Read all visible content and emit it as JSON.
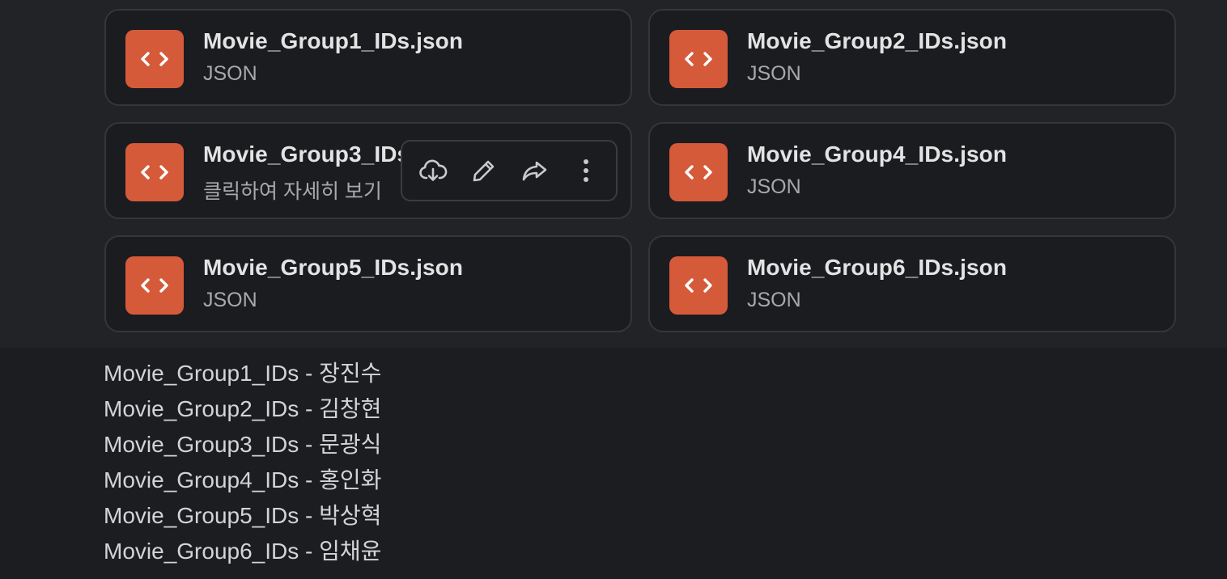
{
  "files": [
    {
      "name": "Movie_Group1_IDs.json",
      "type": "JSON",
      "icon": "code-file-icon"
    },
    {
      "name": "Movie_Group2_IDs.json",
      "type": "JSON",
      "icon": "code-file-icon"
    },
    {
      "name": "Movie_Group3_IDs.json",
      "type": "클릭하여 자세히 보기",
      "icon": "code-file-icon"
    },
    {
      "name": "Movie_Group4_IDs.json",
      "type": "JSON",
      "icon": "code-file-icon"
    },
    {
      "name": "Movie_Group5_IDs.json",
      "type": "JSON",
      "icon": "code-file-icon"
    },
    {
      "name": "Movie_Group6_IDs.json",
      "type": "JSON",
      "icon": "code-file-icon"
    }
  ],
  "hover_actions": [
    "download-cloud-icon",
    "edit-pencil-icon",
    "share-forward-icon",
    "more-vertical-icon"
  ],
  "message_lines": [
    "Movie_Group1_IDs - 장진수",
    "Movie_Group2_IDs - 김창현",
    "Movie_Group3_IDs - 문광식",
    "Movie_Group4_IDs - 홍인화",
    "Movie_Group5_IDs - 박상혁",
    "Movie_Group6_IDs - 임채윤"
  ],
  "colors": {
    "background": "#1c1d21",
    "card_background": "#1b1c1f",
    "card_border": "#34363b",
    "file_icon": "#d55a3a",
    "text_primary": "#e3e3e4",
    "text_secondary": "#a8a9ad"
  }
}
